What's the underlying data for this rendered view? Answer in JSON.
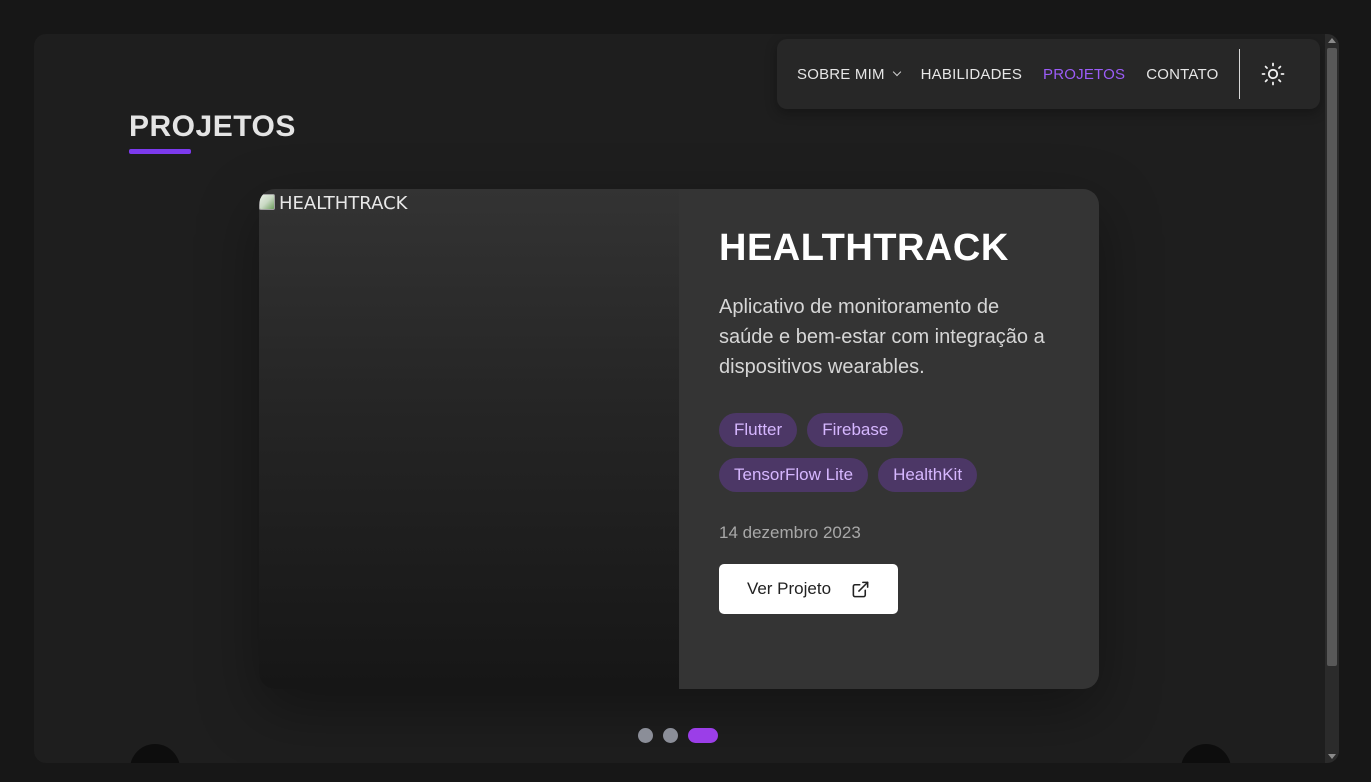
{
  "nav": {
    "items": [
      {
        "label": "SOBRE MIM",
        "has_dropdown": true,
        "active": false
      },
      {
        "label": "HABILIDADES",
        "has_dropdown": false,
        "active": false
      },
      {
        "label": "PROJETOS",
        "has_dropdown": false,
        "active": true
      },
      {
        "label": "CONTATO",
        "has_dropdown": false,
        "active": false
      }
    ],
    "theme_toggle_icon": "sun-icon"
  },
  "section": {
    "title": "PROJETOS"
  },
  "project": {
    "image_alt": "HEALTHTRACK",
    "title": "HEALTHTRACK",
    "description": "Aplicativo de monitoramento de saúde e bem-estar com integração a dispositivos wearables.",
    "tags": [
      "Flutter",
      "Firebase",
      "TensorFlow Lite",
      "HealthKit"
    ],
    "date": "14 dezembro 2023",
    "button_label": "Ver Projeto",
    "button_icon": "external-link-icon"
  },
  "carousel": {
    "total_slides": 3,
    "active_index": 2
  },
  "colors": {
    "accent": "#9b5cf6",
    "tag_bg": "#4c3766",
    "tag_text": "#d6b7ff"
  }
}
